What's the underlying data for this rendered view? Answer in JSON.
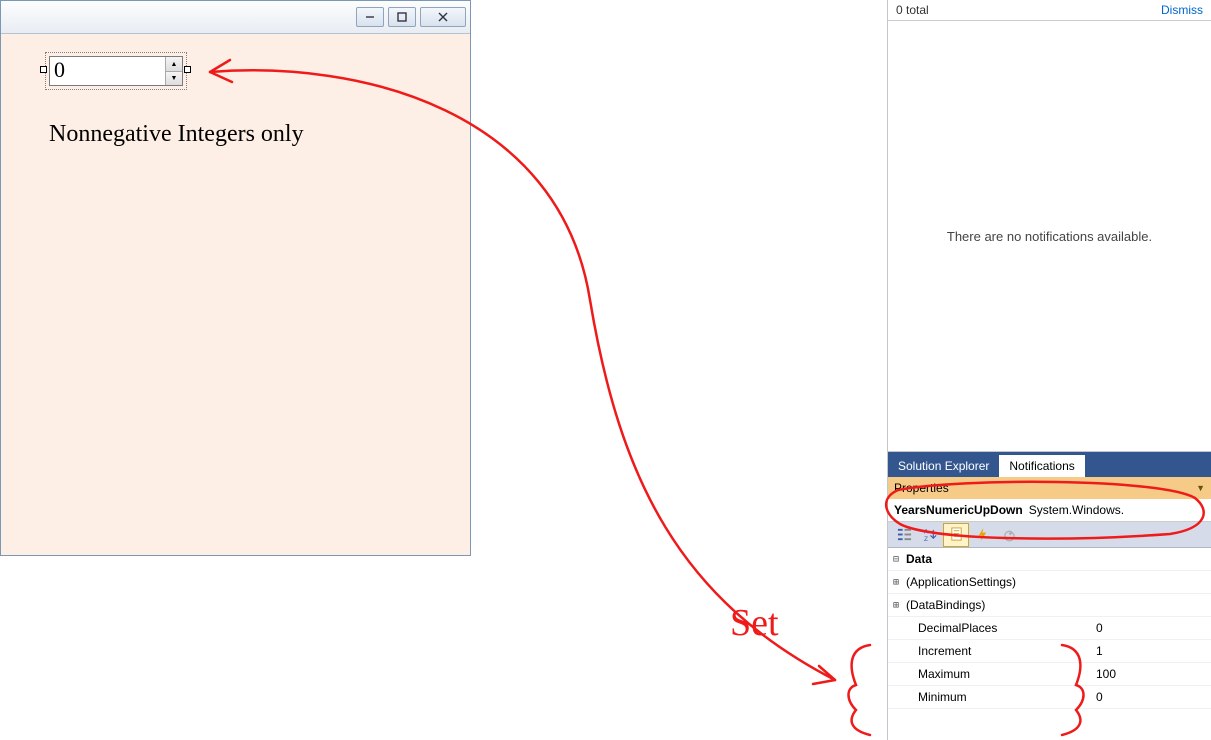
{
  "form": {
    "numeric_value": "0",
    "label_text": "Nonnegative Integers only"
  },
  "notifications": {
    "total_text": "0 total",
    "dismiss": "Dismiss",
    "empty_text": "There are no notifications available."
  },
  "tabs": {
    "solution_explorer": "Solution Explorer",
    "notifications": "Notifications"
  },
  "properties": {
    "panel_title": "Properties",
    "object_name": "YearsNumericUpDown",
    "object_type": "System.Windows.",
    "category_data": "Data",
    "rows": {
      "app_settings": "(ApplicationSettings)",
      "data_bindings": "(DataBindings)",
      "decimal_places": {
        "name": "DecimalPlaces",
        "value": "0"
      },
      "increment": {
        "name": "Increment",
        "value": "1"
      },
      "maximum": {
        "name": "Maximum",
        "value": "100"
      },
      "minimum": {
        "name": "Minimum",
        "value": "0"
      }
    }
  },
  "annotation": {
    "set_text": "Set"
  }
}
